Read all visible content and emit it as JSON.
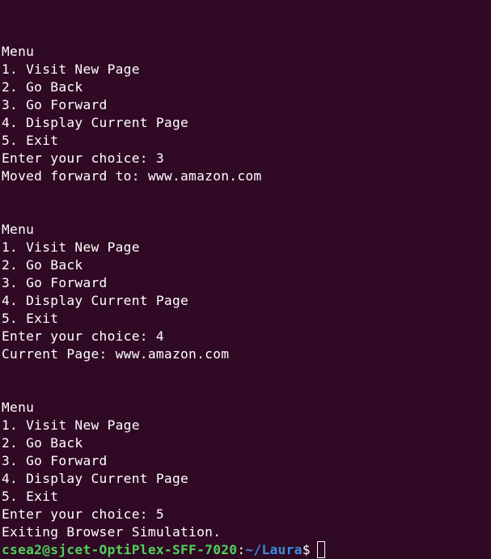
{
  "lines": [
    "",
    "Menu",
    "1. Visit New Page",
    "2. Go Back",
    "3. Go Forward",
    "4. Display Current Page",
    "5. Exit",
    "Enter your choice: 3",
    "Moved forward to: www.amazon.com",
    "",
    "",
    "Menu",
    "1. Visit New Page",
    "2. Go Back",
    "3. Go Forward",
    "4. Display Current Page",
    "5. Exit",
    "Enter your choice: 4",
    "Current Page: www.amazon.com",
    "",
    "",
    "Menu",
    "1. Visit New Page",
    "2. Go Back",
    "3. Go Forward",
    "4. Display Current Page",
    "5. Exit",
    "Enter your choice: 5",
    "Exiting Browser Simulation."
  ],
  "prompt": {
    "user_host": "csea2@sjcet-OptiPlex-SFF-7020",
    "separator": ":",
    "path": "~/Laura",
    "symbol": "$"
  },
  "colors": {
    "background": "#300a24",
    "text": "#ffffff",
    "user_host": "#4fd05b",
    "path": "#3c8be0"
  }
}
